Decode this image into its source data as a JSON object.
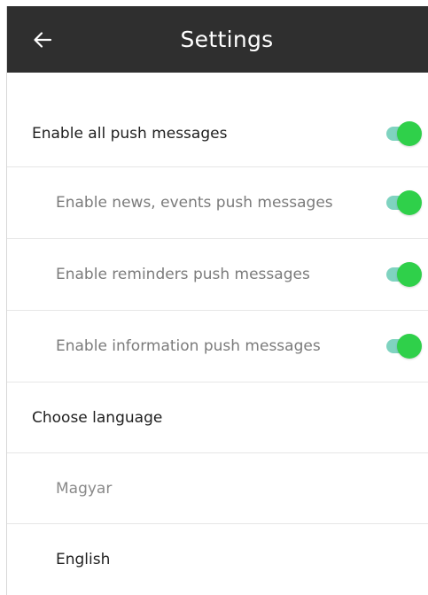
{
  "header": {
    "title": "Settings",
    "back_icon": "arrow-left-icon",
    "background": "#2f2f2f"
  },
  "push": {
    "all": {
      "label": "Enable all push messages",
      "enabled": true
    },
    "news": {
      "label": "Enable news, events push messages",
      "enabled": true
    },
    "reminders": {
      "label": "Enable reminders push messages",
      "enabled": true
    },
    "information": {
      "label": "Enable information push messages",
      "enabled": true
    }
  },
  "language": {
    "heading": "Choose language",
    "options": [
      {
        "label": "Magyar"
      },
      {
        "label": "English"
      }
    ]
  },
  "colors": {
    "toggle_knob": "#2fd04a",
    "toggle_track": "#7fd3c0"
  }
}
